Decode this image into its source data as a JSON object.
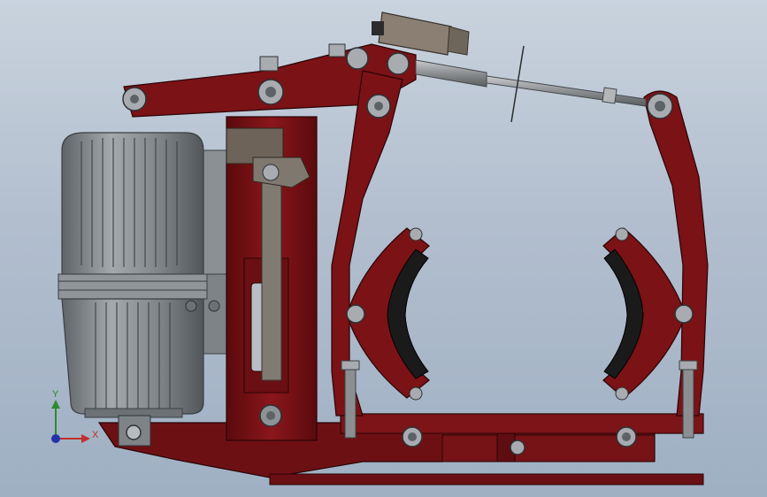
{
  "viewport": {
    "background_top": "#c9d3de",
    "background_bottom": "#9fb0c3"
  },
  "model": {
    "body_color": "#7a1216",
    "body_edge_color": "#3a0507",
    "motor_color": "#8a9094",
    "shoe_lining_color": "#1a1a1a",
    "rod_color": "#8c8f92"
  },
  "axes": {
    "x_label": "X",
    "y_label": "Y",
    "x_color": "#c0302b",
    "y_color": "#2f8a2f",
    "z_color": "#2233aa"
  }
}
